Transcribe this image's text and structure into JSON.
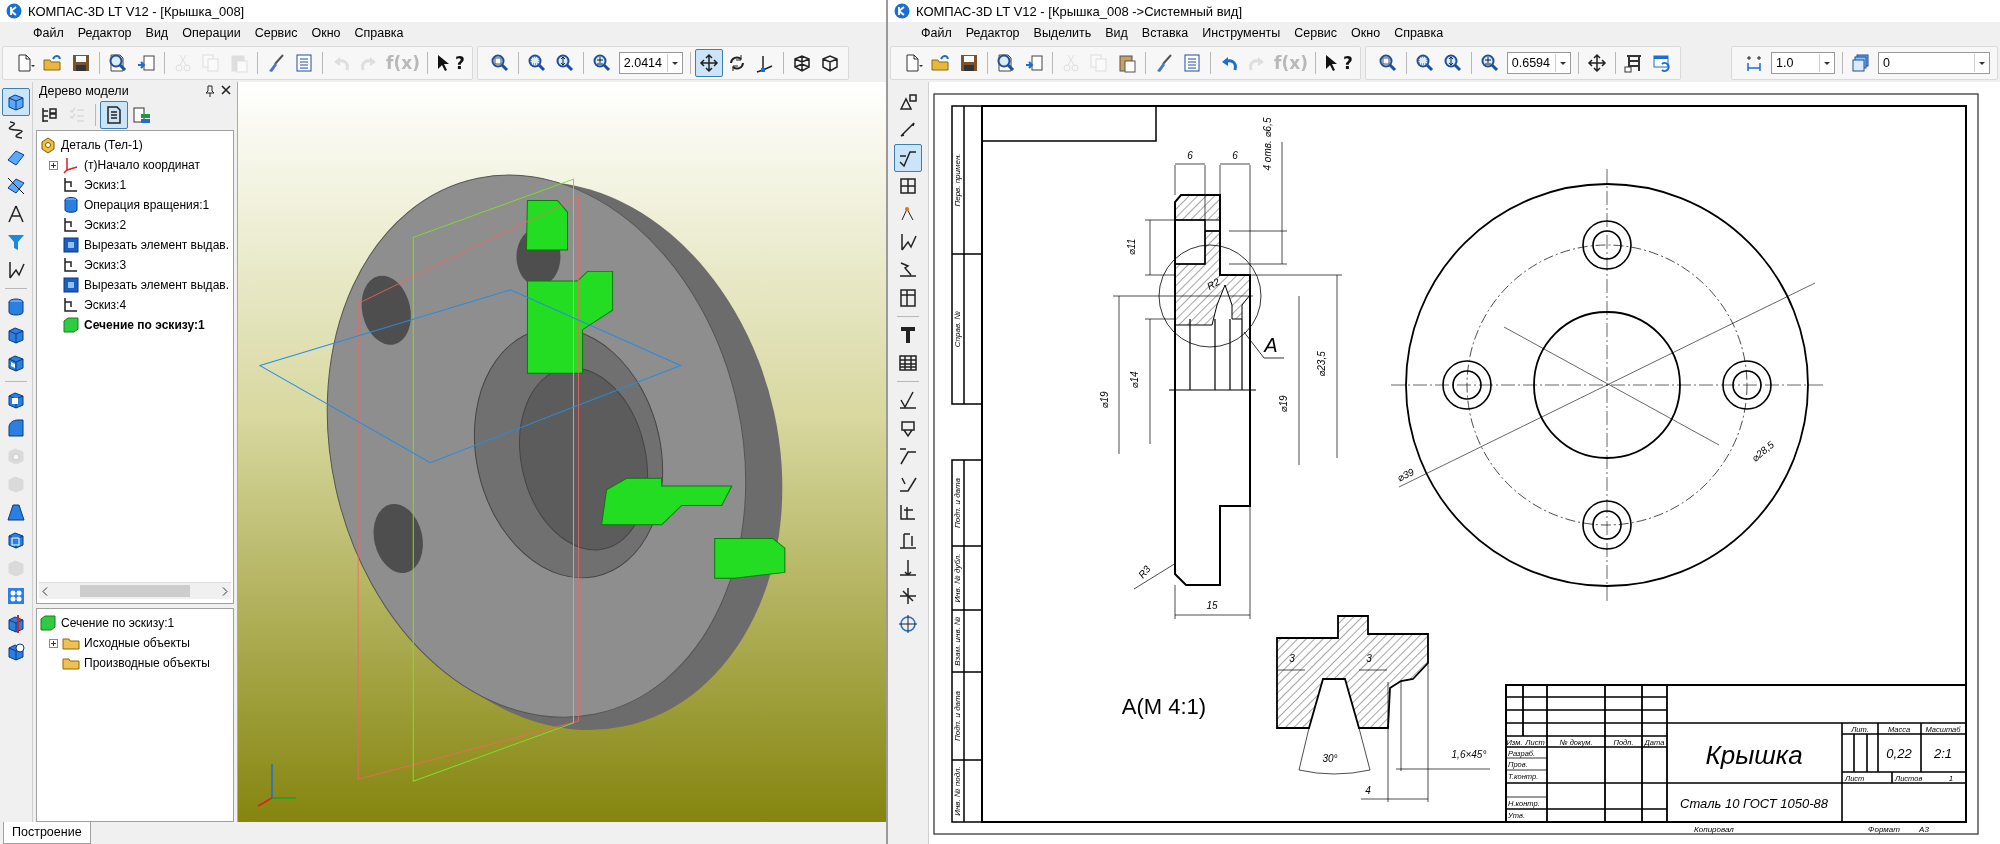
{
  "left_window": {
    "title": "КОМПАС-3D LT V12 - [Крышка_008]",
    "menu": [
      "Файл",
      "Редактор",
      "Вид",
      "Операции",
      "Сервис",
      "Окно",
      "Справка"
    ],
    "toolbars": [
      {
        "items": [
          {
            "kind": "new",
            "on": false,
            "disabled": false
          },
          {
            "kind": "open",
            "on": false,
            "disabled": false
          },
          {
            "kind": "save",
            "on": false,
            "disabled": false
          },
          {
            "kind": "separator"
          },
          {
            "kind": "preview",
            "on": false,
            "disabled": false
          },
          {
            "kind": "fragment",
            "on": false,
            "disabled": false
          },
          {
            "kind": "separator"
          },
          {
            "kind": "cut",
            "on": false,
            "disabled": true
          },
          {
            "kind": "copy",
            "on": false,
            "disabled": true
          },
          {
            "kind": "paste",
            "on": false,
            "disabled": true
          },
          {
            "kind": "separator"
          },
          {
            "kind": "brush",
            "on": false,
            "disabled": false
          },
          {
            "kind": "list",
            "on": false,
            "disabled": false
          },
          {
            "kind": "separator"
          },
          {
            "kind": "undo",
            "on": false,
            "disabled": true
          },
          {
            "kind": "redo",
            "on": false,
            "disabled": true
          },
          {
            "kind": "formula",
            "label": "f(x)",
            "on": false,
            "disabled": true
          },
          {
            "kind": "separator"
          },
          {
            "kind": "help",
            "label": "?",
            "on": false,
            "disabled": false
          }
        ]
      },
      {
        "items": [
          {
            "kind": "zoom",
            "on": false,
            "disabled": false
          },
          {
            "kind": "separator"
          },
          {
            "kind": "zoomarea",
            "on": false,
            "disabled": false
          },
          {
            "kind": "zoomscale",
            "on": false,
            "disabled": false
          },
          {
            "kind": "separator"
          },
          {
            "kind": "zoomfit",
            "on": false,
            "disabled": false
          },
          {
            "kind": "field",
            "value": "2.0414"
          },
          {
            "kind": "separator"
          },
          {
            "kind": "pan",
            "on": true,
            "disabled": false
          },
          {
            "kind": "rotate",
            "on": false,
            "disabled": false
          },
          {
            "kind": "orient",
            "on": false,
            "disabled": false
          },
          {
            "kind": "separator"
          },
          {
            "kind": "wireframe",
            "on": false,
            "disabled": false
          },
          {
            "kind": "shaded",
            "on": false,
            "disabled": false
          }
        ]
      }
    ],
    "vertical_toolbar": [
      {
        "kind": "cube",
        "on": true,
        "disabled": false
      },
      {
        "kind": "curve",
        "on": false,
        "disabled": false
      },
      {
        "kind": "plane",
        "on": false,
        "disabled": false
      },
      {
        "kind": "cutplane",
        "on": false,
        "disabled": false
      },
      {
        "kind": "compass",
        "on": false,
        "disabled": false
      },
      {
        "kind": "filter",
        "on": false,
        "disabled": false
      },
      {
        "kind": "measure",
        "on": false,
        "disabled": false
      },
      {
        "kind": "separator"
      },
      {
        "kind": "revolve",
        "on": false,
        "disabled": false
      },
      {
        "kind": "extrude",
        "on": false,
        "disabled": false
      },
      {
        "kind": "cutextrude",
        "on": false,
        "disabled": false
      },
      {
        "kind": "separator"
      },
      {
        "kind": "shell",
        "on": false,
        "disabled": false
      },
      {
        "kind": "fillet",
        "on": false,
        "disabled": false
      },
      {
        "kind": "hole",
        "on": false,
        "disabled": true
      },
      {
        "kind": "rib",
        "on": false,
        "disabled": true
      },
      {
        "kind": "loft",
        "on": false,
        "disabled": false
      },
      {
        "kind": "boxcut",
        "on": false,
        "disabled": false
      },
      {
        "kind": "copy3d",
        "on": false,
        "disabled": true
      },
      {
        "kind": "array",
        "on": false,
        "disabled": false
      },
      {
        "kind": "mirror",
        "on": false,
        "disabled": false
      },
      {
        "kind": "combine",
        "on": false,
        "disabled": false
      }
    ],
    "model_tree": {
      "title": "Дерево модели",
      "toolbar": [
        {
          "kind": "tree",
          "on": false,
          "disabled": false
        },
        {
          "kind": "checklist",
          "on": false,
          "disabled": true
        },
        {
          "kind": "separator"
        },
        {
          "kind": "page",
          "on": true,
          "disabled": false
        },
        {
          "kind": "rebuild",
          "on": false,
          "disabled": false
        }
      ],
      "root": {
        "label": "Деталь (Тел-1)",
        "kind": "part",
        "children": [
          {
            "label": "(т)Начало координат",
            "kind": "origin",
            "collapsed": true,
            "current": false
          },
          {
            "label": "Эскиз:1",
            "kind": "sketch",
            "collapsed": false,
            "current": false
          },
          {
            "label": "Операция вращения:1",
            "kind": "revolve",
            "collapsed": false,
            "current": false
          },
          {
            "label": "Эскиз:2",
            "kind": "sketch",
            "collapsed": false,
            "current": false
          },
          {
            "label": "Вырезать элемент выдав.",
            "kind": "cut",
            "collapsed": false,
            "current": false
          },
          {
            "label": "Эскиз:3",
            "kind": "sketch",
            "collapsed": false,
            "current": false
          },
          {
            "label": "Вырезать элемент выдав.",
            "kind": "cut",
            "collapsed": false,
            "current": false
          },
          {
            "label": "Эскиз:4",
            "kind": "sketch",
            "collapsed": false,
            "current": false
          },
          {
            "label": "Сечение по эскизу:1",
            "kind": "section",
            "collapsed": false,
            "current": true
          }
        ]
      },
      "detail": {
        "label": "Сечение по эскизу:1",
        "children": [
          {
            "label": "Исходные объекты",
            "collapsed": true
          },
          {
            "label": "Производные объекты",
            "collapsed": false
          }
        ]
      }
    },
    "tabs": [
      {
        "label": "Построение",
        "selected": true
      }
    ]
  },
  "right_window": {
    "title": "КОМПАС-3D LT V12 - [Крышка_008 ->Системный вид]",
    "menu": [
      "Файл",
      "Редактор",
      "Выделить",
      "Вид",
      "Вставка",
      "Инструменты",
      "Сервис",
      "Окно",
      "Справка"
    ],
    "toolbars": [
      {
        "items": [
          {
            "kind": "new",
            "on": false,
            "disabled": false
          },
          {
            "kind": "open",
            "on": false,
            "disabled": false
          },
          {
            "kind": "save",
            "on": false,
            "disabled": false
          },
          {
            "kind": "separator"
          },
          {
            "kind": "preview",
            "on": false,
            "disabled": false
          },
          {
            "kind": "fragment",
            "on": false,
            "disabled": false
          },
          {
            "kind": "separator"
          },
          {
            "kind": "cut",
            "on": false,
            "disabled": true
          },
          {
            "kind": "copy",
            "on": false,
            "disabled": true
          },
          {
            "kind": "paste",
            "on": false,
            "disabled": false
          },
          {
            "kind": "separator"
          },
          {
            "kind": "brush",
            "on": false,
            "disabled": false
          },
          {
            "kind": "list",
            "on": false,
            "disabled": false
          },
          {
            "kind": "separator"
          },
          {
            "kind": "undo",
            "on": false,
            "disabled": false
          },
          {
            "kind": "redo",
            "on": false,
            "disabled": true
          },
          {
            "kind": "formula",
            "label": "f(x)",
            "on": false,
            "disabled": true
          },
          {
            "kind": "separator"
          },
          {
            "kind": "help",
            "label": "?",
            "on": false,
            "disabled": false
          }
        ]
      },
      {
        "items": [
          {
            "kind": "zoom",
            "on": false,
            "disabled": false
          },
          {
            "kind": "separator"
          },
          {
            "kind": "zoomarea",
            "on": false,
            "disabled": false
          },
          {
            "kind": "zoomscale",
            "on": false,
            "disabled": false
          },
          {
            "kind": "separator"
          },
          {
            "kind": "zoomfit",
            "on": false,
            "disabled": false
          },
          {
            "kind": "field",
            "value": "0.6594"
          },
          {
            "kind": "separator"
          },
          {
            "kind": "pan",
            "on": false,
            "disabled": false
          },
          {
            "kind": "separator"
          },
          {
            "kind": "grid",
            "on": false,
            "disabled": false
          },
          {
            "kind": "refresh",
            "on": false,
            "disabled": false
          }
        ]
      },
      {
        "items": [
          {
            "kind": "snap",
            "on": false,
            "disabled": false
          },
          {
            "kind": "field",
            "value": "1.0"
          },
          {
            "kind": "separator"
          },
          {
            "kind": "layers",
            "on": false,
            "disabled": false
          },
          {
            "kind": "field",
            "value": "0"
          }
        ]
      }
    ],
    "vertical_toolbar": [
      {
        "kind": "geometry",
        "on": false,
        "disabled": false
      },
      {
        "kind": "dimension",
        "on": false,
        "disabled": false
      },
      {
        "kind": "symbols",
        "on": true,
        "disabled": false
      },
      {
        "kind": "edit",
        "on": false,
        "disabled": false
      },
      {
        "kind": "param",
        "on": false,
        "disabled": false
      },
      {
        "kind": "measure",
        "on": false,
        "disabled": false
      },
      {
        "kind": "select",
        "on": false,
        "disabled": false
      },
      {
        "kind": "spec",
        "on": false,
        "disabled": false
      },
      {
        "kind": "separator"
      },
      {
        "kind": "text",
        "on": false,
        "disabled": false
      },
      {
        "kind": "table",
        "on": false,
        "disabled": false
      },
      {
        "kind": "separator"
      },
      {
        "kind": "roughness",
        "on": false,
        "disabled": false
      },
      {
        "kind": "base",
        "on": false,
        "disabled": false
      },
      {
        "kind": "leader",
        "on": false,
        "disabled": false
      },
      {
        "kind": "position",
        "on": false,
        "disabled": false
      },
      {
        "kind": "tolerance",
        "on": false,
        "disabled": false
      },
      {
        "kind": "cutline",
        "on": false,
        "disabled": false
      },
      {
        "kind": "viewarrow",
        "on": false,
        "disabled": false
      },
      {
        "kind": "datum",
        "on": false,
        "disabled": false
      },
      {
        "kind": "center",
        "on": false,
        "disabled": false
      }
    ],
    "drawing": {
      "side_strip": [
        "Перв. примен.",
        "Справ. №",
        "Подп. и дата",
        "Инв. № дубл.",
        "Взам. инв. №",
        "Подп. и дата",
        "Инв. № подл."
      ],
      "main_view_labels": [
        "6",
        "6",
        "4 отв. ⌀6,5",
        "⌀11",
        "R2",
        "A",
        "⌀23,5",
        "⌀19",
        "⌀14",
        "⌀19",
        "R3",
        "15"
      ],
      "plan_view_labels": [
        "⌀39",
        "⌀28,5"
      ],
      "detail_view": {
        "title": "A(M 4:1)",
        "labels": [
          "3",
          "3",
          "30°",
          "1,6×45°",
          "4"
        ]
      },
      "title_block": {
        "headers": [
          "Изм.",
          "Лист",
          "№ докум.",
          "Подп.",
          "Дата"
        ],
        "roles": [
          "Разраб.",
          "Пров.",
          "Т.контр.",
          "Н.контр.",
          "Утв."
        ],
        "name": "Крышка",
        "material": "Сталь 10  ГОСТ 1050-88",
        "columns": [
          "Лит.",
          "Масса",
          "Масштаб"
        ],
        "mass": "0,22",
        "scale": "2:1",
        "sheet": "Лист",
        "sheets": "Листов",
        "sheets_count": "1",
        "copied": "Копировал",
        "format_label": "Формат",
        "format": "А3"
      }
    }
  }
}
